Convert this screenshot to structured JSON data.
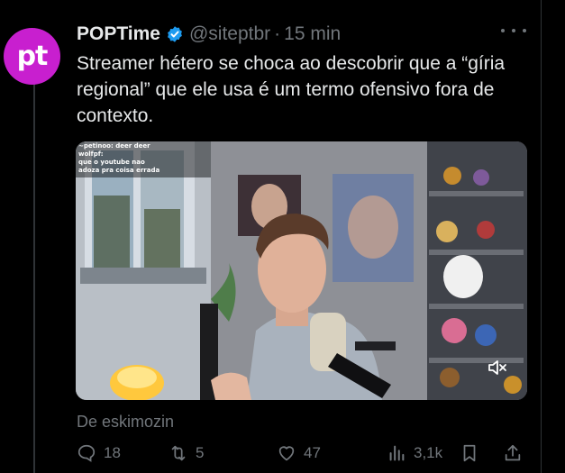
{
  "post": {
    "avatar_text": "pt",
    "author_name": "POPTime",
    "handle": "@siteptbr",
    "separator": "·",
    "time": "15 min",
    "text": "Streamer hétero se choca ao descobrir que a “gíria regional” que ele usa é um termo ofensivo fora de contexto.",
    "media_overlay_lines": [
      "~petinoo: deer deer",
      "wolfpf:",
      "que o youtube nao",
      "adoza pra coisa errada"
    ],
    "credit": "De eskimozin"
  },
  "actions": {
    "replies": "18",
    "reposts": "5",
    "likes": "47",
    "views": "3,1k"
  },
  "colors": {
    "avatar_bg": "#c81fcf",
    "verified": "#1d9bf0",
    "muted_text": "#71767b",
    "text": "#e7e9ea"
  },
  "icons": [
    "verified-badge-icon",
    "more-icon",
    "mute-icon",
    "reply-icon",
    "repost-icon",
    "like-icon",
    "views-icon",
    "bookmark-icon",
    "share-icon"
  ]
}
